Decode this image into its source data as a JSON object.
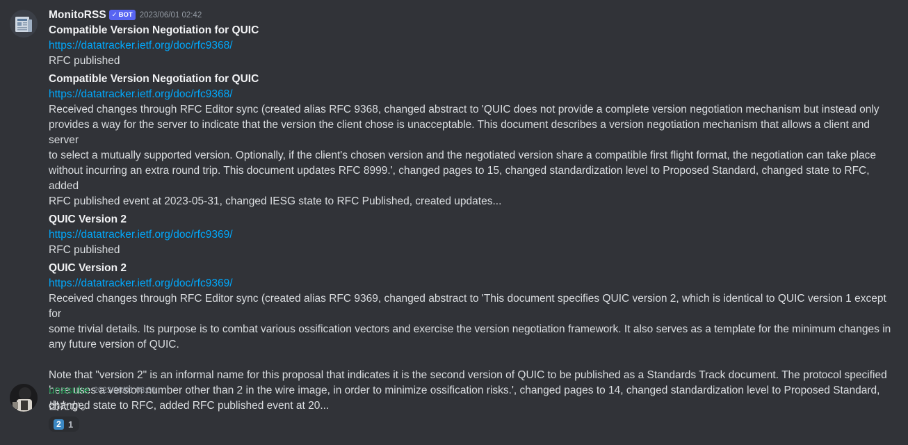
{
  "messages": [
    {
      "username": "MonitoRSS",
      "bot_tag": "BOT",
      "bot_check": "✓",
      "timestamp": "2023/06/01 02:42",
      "avatar_icon": "rss-feed-icon",
      "items": [
        {
          "title": "Compatible Version Negotiation for QUIC",
          "link": "https://datatracker.ietf.org/doc/rfc9368/",
          "body": "RFC published"
        },
        {
          "title": "Compatible Version Negotiation for QUIC",
          "link": "https://datatracker.ietf.org/doc/rfc9368/",
          "body": "Received changes through RFC Editor sync (created alias RFC 9368, changed abstract to 'QUIC does not provide a complete version negotiation mechanism but instead only\nprovides a way for the server to indicate that the version the client chose is unacceptable. This document describes a version negotiation mechanism that allows a client and server\nto select a mutually supported version. Optionally, if the client's chosen version and the negotiated version share a compatible first flight format, the negotiation can take place\nwithout incurring an extra round trip. This document updates RFC 8999.', changed pages to 15, changed standardization level to Proposed Standard, changed state to RFC, added\nRFC published event at 2023-05-31, changed IESG state to RFC Published, created updates..."
        },
        {
          "title": "QUIC Version 2",
          "link": "https://datatracker.ietf.org/doc/rfc9369/",
          "body": "RFC published"
        },
        {
          "title": "QUIC Version 2",
          "link": "https://datatracker.ietf.org/doc/rfc9369/",
          "body": "Received changes through RFC Editor sync (created alias RFC 9369, changed abstract to 'This document specifies QUIC version 2, which is identical to QUIC version 1 except for\nsome trivial details. Its purpose is to combat various ossification vectors and exercise the version negotiation framework. It also serves as a template for the minimum changes in\nany future version of QUIC.\n\nNote that \"version 2\" is an informal name for this proposal that indicates it is the second version of QUIC to be published as a Standards Track document. The protocol specified\nhere uses a version number other than 2 in the wire image, in order to minimize ossification risks.', changed pages to 14, changed standardization level to Proposed Standard,\nchanged state to RFC, added RFC published event at 20..."
        }
      ]
    },
    {
      "username": "unasuke",
      "timestamp": "2023/06/01 08:30",
      "avatar_icon": "user-avatar",
      "text": "出たか。",
      "reaction": {
        "emoji": "2",
        "emoji_name": "keycap-2-emoji",
        "count": "1"
      }
    }
  ]
}
